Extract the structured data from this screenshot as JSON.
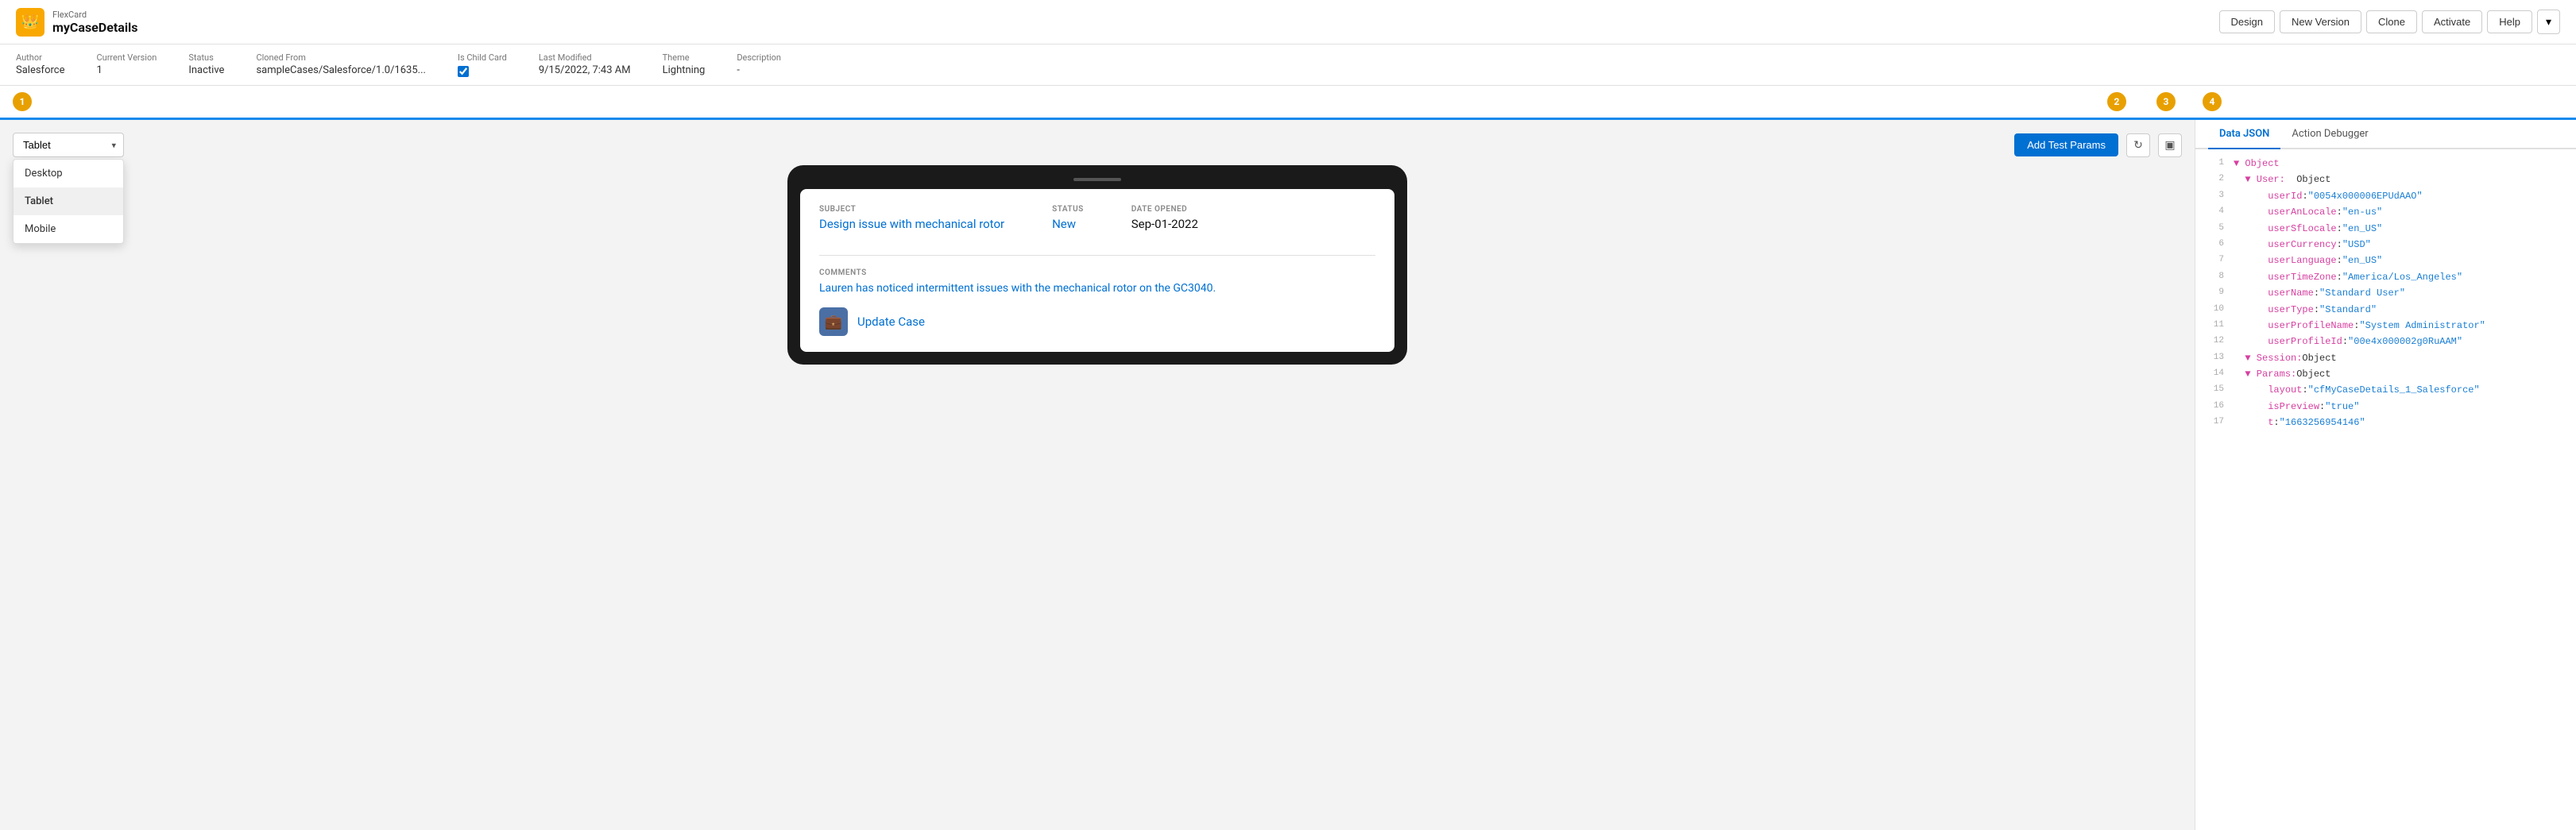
{
  "header": {
    "app_name": "FlexCard",
    "card_name": "myCaseDetails",
    "logo_icon": "👑",
    "buttons": {
      "design": "Design",
      "new_version": "New Version",
      "clone": "Clone",
      "activate": "Activate",
      "help": "Help"
    }
  },
  "meta": {
    "author_label": "Author",
    "author_value": "Salesforce",
    "version_label": "Current Version",
    "version_value": "1",
    "status_label": "Status",
    "status_value": "Inactive",
    "cloned_label": "Cloned From",
    "cloned_value": "sampleCases/Salesforce/1.0/1635...",
    "is_child_label": "Is Child Card",
    "is_child_checked": true,
    "last_modified_label": "Last Modified",
    "last_modified_value": "9/15/2022, 7:43 AM",
    "theme_label": "Theme",
    "theme_value": "Lightning",
    "description_label": "Description",
    "description_value": "-"
  },
  "toolbar": {
    "device_options": [
      "Desktop",
      "Tablet",
      "Mobile"
    ],
    "selected_device": "Tablet",
    "add_test_label": "Add Test Params",
    "refresh_icon": "↻",
    "layout_icon": "▣"
  },
  "badges": {
    "b1": "1",
    "b2": "2",
    "b3": "3",
    "b4": "4"
  },
  "card_preview": {
    "subject_label": "SUBJECT",
    "subject_value": "Design issue with mechanical rotor",
    "status_label": "STATUS",
    "status_value": "New",
    "date_label": "DATE OPENED",
    "date_value": "Sep-01-2022",
    "comments_label": "COMMENTS",
    "comments_value": "Lauren has noticed intermittent issues with the mechanical rotor on the GC3040.",
    "update_button": "Update Case"
  },
  "json_panel": {
    "tab_data": "Data JSON",
    "tab_debugger": "Action Debugger",
    "lines": [
      {
        "num": 1,
        "indent": 0,
        "content": "▼ Object"
      },
      {
        "num": 2,
        "indent": 1,
        "content": "▼ User:  Object"
      },
      {
        "num": 3,
        "indent": 2,
        "content": "userId: \"0054x000006EPUdAAO\""
      },
      {
        "num": 4,
        "indent": 2,
        "content": "userAnLocale: \"en-us\""
      },
      {
        "num": 5,
        "indent": 2,
        "content": "userSfLocale: \"en_US\""
      },
      {
        "num": 6,
        "indent": 2,
        "content": "userCurrency: \"USD\""
      },
      {
        "num": 7,
        "indent": 2,
        "content": "userLanguage: \"en_US\""
      },
      {
        "num": 8,
        "indent": 2,
        "content": "userTimeZone: \"America/Los_Angeles\""
      },
      {
        "num": 9,
        "indent": 2,
        "content": "userName: \"Standard User\""
      },
      {
        "num": 10,
        "indent": 2,
        "content": "userType: \"Standard\""
      },
      {
        "num": 11,
        "indent": 2,
        "content": "userProfileName: \"System Administrator\""
      },
      {
        "num": 12,
        "indent": 2,
        "content": "userProfileId: \"00e4x000002g0RuAAM\""
      },
      {
        "num": 13,
        "indent": 1,
        "content": "▼ Session: Object"
      },
      {
        "num": 14,
        "indent": 1,
        "content": "▼ Params: Object"
      },
      {
        "num": 15,
        "indent": 2,
        "content": "layout: \"cfMyCaseDetails_1_Salesforce\""
      },
      {
        "num": 16,
        "indent": 2,
        "content": "isPreview: \"true\""
      },
      {
        "num": 17,
        "indent": 2,
        "content": "t: \"1663256954146\""
      }
    ]
  }
}
